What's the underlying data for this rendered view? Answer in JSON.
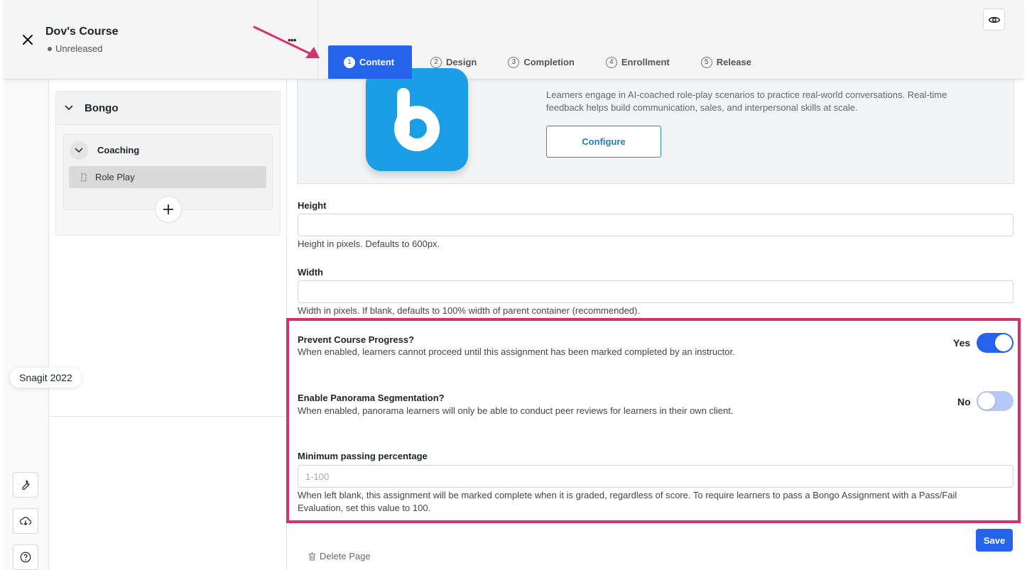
{
  "header": {
    "course_title": "Dov's Course",
    "status": "Unreleased",
    "more_icon": "•••",
    "tabs": [
      {
        "num": "1",
        "label": "Content",
        "active": true
      },
      {
        "num": "2",
        "label": "Design",
        "active": false
      },
      {
        "num": "3",
        "label": "Completion",
        "active": false
      },
      {
        "num": "4",
        "label": "Enrollment",
        "active": false
      },
      {
        "num": "5",
        "label": "Release",
        "active": false
      }
    ],
    "icons": {
      "close": "close-icon",
      "preview": "eye-icon",
      "more": "more-icon"
    }
  },
  "outline": {
    "section_title": "Bongo",
    "subsection_title": "Coaching",
    "page_label": "Role Play"
  },
  "overlay": {
    "snagit_label": "Snagit 2022",
    "highlight_color": "#d6306f"
  },
  "bongo": {
    "description": "Learners engage in AI-coached role-play scenarios to practice real-world conversations. Real-time feedback helps build communication, sales, and interpersonal skills at scale.",
    "configure_label": "Configure",
    "logo_letter": "b",
    "brand_color": "#1a9fe6"
  },
  "form": {
    "height": {
      "label": "Height",
      "value": "",
      "hint": "Height in pixels. Defaults to 600px."
    },
    "width": {
      "label": "Width",
      "value": "",
      "hint": "Width in pixels. If blank, defaults to 100% width of parent container (recommended)."
    },
    "prevent_progress": {
      "title": "Prevent Course Progress?",
      "hint": "When enabled, learners cannot proceed until this assignment has been marked completed by an instructor.",
      "state_label": "Yes",
      "enabled": true
    },
    "panorama": {
      "title": "Enable Panorama Segmentation?",
      "hint": "When enabled, panorama learners will only be able to conduct peer reviews for learners in their own client.",
      "state_label": "No",
      "enabled": false
    },
    "min_passing": {
      "label": "Minimum passing percentage",
      "placeholder": "1-100",
      "value": "",
      "hint": "When left blank, this assignment will be marked complete when it is graded, regardless of score. To require learners to pass a Bongo Assignment with a Pass/Fail Evaluation, set this value to 100."
    }
  },
  "footer": {
    "save_label": "Save",
    "delete_label": "Delete Page"
  },
  "accent_color": "#2563eb"
}
